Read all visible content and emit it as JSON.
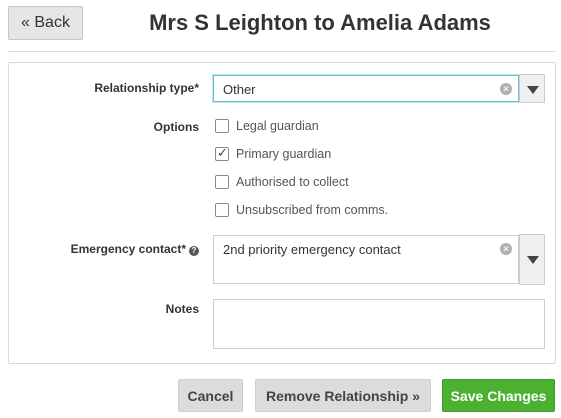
{
  "header": {
    "back_label": "« Back",
    "title": "Mrs S Leighton to Amelia Adams"
  },
  "form": {
    "relationship_type": {
      "label": "Relationship type*",
      "value": "Other",
      "clear_icon": "clear-circle-icon"
    },
    "options": {
      "label": "Options",
      "items": [
        {
          "label": "Legal guardian",
          "checked": false
        },
        {
          "label": "Primary guardian",
          "checked": true
        },
        {
          "label": "Authorised to collect",
          "checked": false
        },
        {
          "label": "Unsubscribed from comms.",
          "checked": false
        }
      ]
    },
    "emergency_contact": {
      "label": "Emergency contact*",
      "help_icon": "question-circle-icon",
      "value": "2nd priority emergency contact"
    },
    "notes": {
      "label": "Notes",
      "value": ""
    }
  },
  "footer": {
    "cancel_label": "Cancel",
    "remove_label": "Remove Relationship »",
    "save_label": "Save Changes"
  },
  "colors": {
    "save_button": "#4cb031",
    "focus_border": "#66c1d1",
    "grey_button": "#dcdcdc"
  }
}
